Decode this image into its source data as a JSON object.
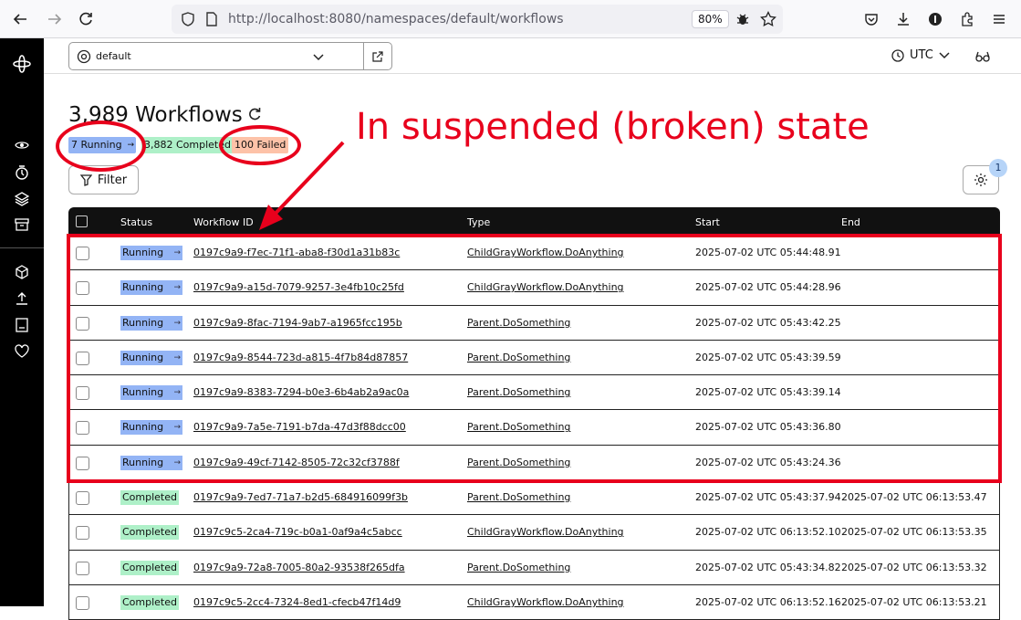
{
  "browser": {
    "url_host": "http://localhost",
    "url_rest": ":8080/namespaces/default/workflows",
    "zoom": "80%"
  },
  "topbar": {
    "namespace": "default",
    "timezone": "UTC"
  },
  "page": {
    "title": "3,989 Workflows",
    "running_chip": "7 Running",
    "completed_chip": "3,882 Completed",
    "failed_chip": "100 Failed",
    "filter_label": "Filter",
    "settings_badge": "1"
  },
  "table": {
    "headers": {
      "status": "Status",
      "workflow_id": "Workflow ID",
      "type": "Type",
      "start": "Start",
      "end": "End"
    },
    "rows": [
      {
        "status": "Running",
        "id": "0197c9a9-f7ec-71f1-aba8-f30d1a31b83c",
        "type": "ChildGrayWorkflow.DoAnything",
        "start": "2025-07-02 UTC 05:44:48.91",
        "end": ""
      },
      {
        "status": "Running",
        "id": "0197c9a9-a15d-7079-9257-3e4fb10c25fd",
        "type": "ChildGrayWorkflow.DoAnything",
        "start": "2025-07-02 UTC 05:44:28.96",
        "end": ""
      },
      {
        "status": "Running",
        "id": "0197c9a9-8fac-7194-9ab7-a1965fcc195b",
        "type": "Parent.DoSomething",
        "start": "2025-07-02 UTC 05:43:42.25",
        "end": ""
      },
      {
        "status": "Running",
        "id": "0197c9a9-8544-723d-a815-4f7b84d87857",
        "type": "Parent.DoSomething",
        "start": "2025-07-02 UTC 05:43:39.59",
        "end": ""
      },
      {
        "status": "Running",
        "id": "0197c9a9-8383-7294-b0e3-6b4ab2a9ac0a",
        "type": "Parent.DoSomething",
        "start": "2025-07-02 UTC 05:43:39.14",
        "end": ""
      },
      {
        "status": "Running",
        "id": "0197c9a9-7a5e-7191-b7da-47d3f88dcc00",
        "type": "Parent.DoSomething",
        "start": "2025-07-02 UTC 05:43:36.80",
        "end": ""
      },
      {
        "status": "Running",
        "id": "0197c9a9-49cf-7142-8505-72c32cf3788f",
        "type": "Parent.DoSomething",
        "start": "2025-07-02 UTC 05:43:24.36",
        "end": ""
      },
      {
        "status": "Completed",
        "id": "0197c9a9-7ed7-71a7-b2d5-684916099f3b",
        "type": "Parent.DoSomething",
        "start": "2025-07-02 UTC 05:43:37.94",
        "end": "2025-07-02 UTC 06:13:53.47"
      },
      {
        "status": "Completed",
        "id": "0197c9c5-2ca4-719c-b0a1-0af9a4c5abcc",
        "type": "ChildGrayWorkflow.DoAnything",
        "start": "2025-07-02 UTC 06:13:52.10",
        "end": "2025-07-02 UTC 06:13:53.35"
      },
      {
        "status": "Completed",
        "id": "0197c9a9-72a8-7005-80a2-93538f265dfa",
        "type": "Parent.DoSomething",
        "start": "2025-07-02 UTC 05:43:34.82",
        "end": "2025-07-02 UTC 06:13:53.32"
      },
      {
        "status": "Completed",
        "id": "0197c9c5-2cc4-7324-8ed1-cfecb47f14d9",
        "type": "ChildGrayWorkflow.DoAnything",
        "start": "2025-07-02 UTC 06:13:52.16",
        "end": "2025-07-02 UTC 06:13:53.21"
      }
    ]
  },
  "annotation": {
    "text": "In suspended (broken) state",
    "color": "#e8001c"
  }
}
